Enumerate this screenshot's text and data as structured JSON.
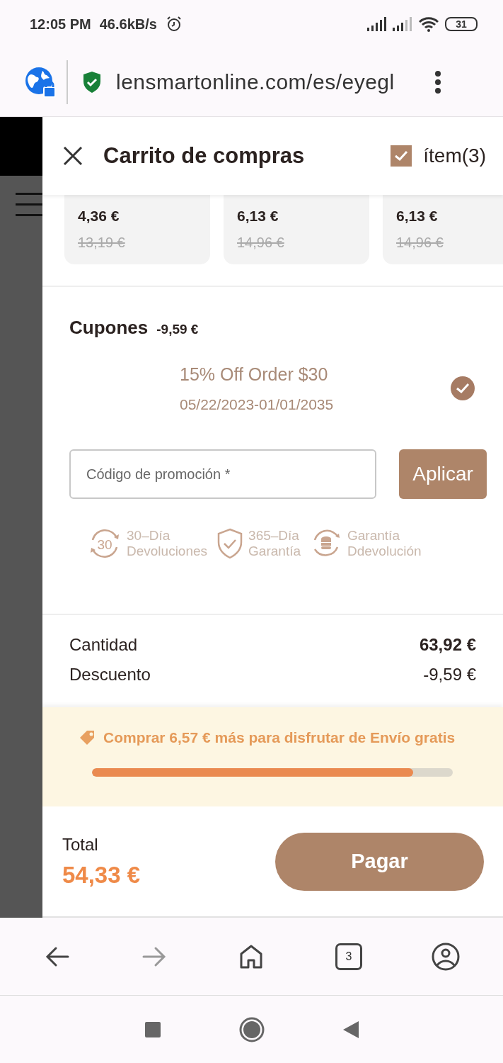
{
  "status_bar": {
    "time": "12:05 PM",
    "speed": "46.6kB/s",
    "battery": "31"
  },
  "browser": {
    "url": "lensmartonline.com/es/eyegl",
    "tab_count": "3",
    "forward_disabled": true
  },
  "cart": {
    "title": "Carrito de compras",
    "select_all": {
      "checked": true,
      "label": "ítem(3)"
    },
    "products": [
      {
        "price": "4,36 €",
        "original_price": "13,19 €"
      },
      {
        "price": "6,13 €",
        "original_price": "14,96 €"
      },
      {
        "price": "6,13 €",
        "original_price": "14,96 €"
      }
    ],
    "coupons": {
      "title": "Cupones",
      "discount": "-9,59 €",
      "items": [
        {
          "name": "15% Off Order $30",
          "validity": "05/22/2023-01/01/2035",
          "selected": true
        }
      ],
      "promo_field": {
        "placeholder": "Código de promoción *"
      },
      "apply_button": "Aplicar"
    },
    "guarantees": [
      {
        "kind": "returns",
        "badge": "30",
        "label": "30–Día\nDevoluciones"
      },
      {
        "kind": "warranty",
        "label": "365–Día\nGarantía"
      },
      {
        "kind": "refund",
        "label": "Garantía\nDdevolución"
      }
    ],
    "summary": [
      {
        "label": "Cantidad",
        "value": "63,92 €",
        "bold": true
      },
      {
        "label": "Descuento",
        "value": "-9,59 €",
        "bold": false
      }
    ],
    "free_shipping": {
      "message": "Comprar **6,57 €** más para disfrutar de **Envío gratis**",
      "level": 0.89
    },
    "footer": {
      "total_label": "Total",
      "total": "54,33 €",
      "pay_button": "Pagar"
    }
  }
}
